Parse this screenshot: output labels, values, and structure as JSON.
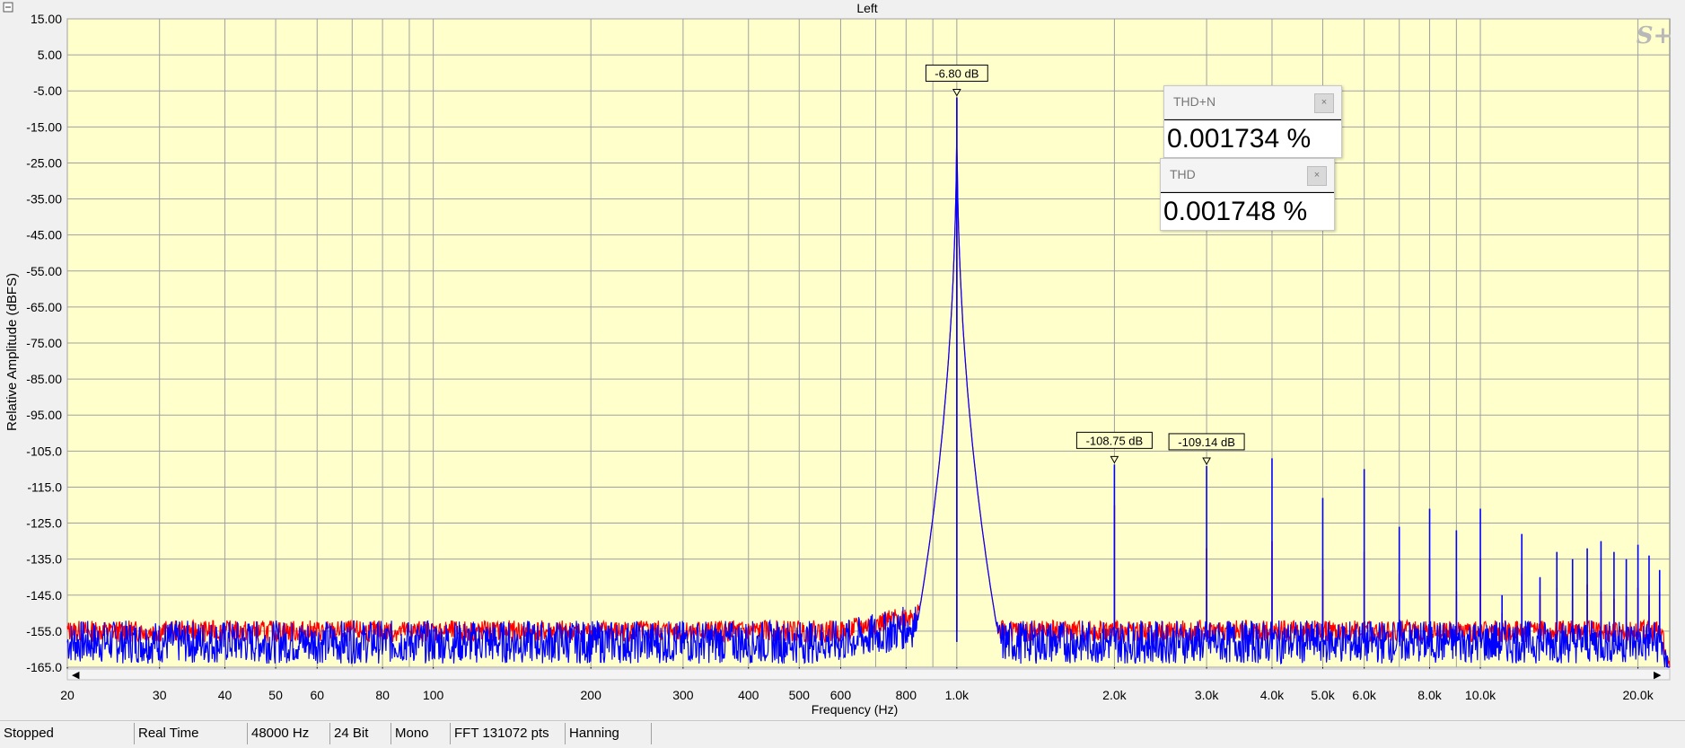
{
  "window": {
    "collapse_icon": "minus-box-icon",
    "logo_text": "S+"
  },
  "chart_data": {
    "type": "line",
    "title": "Left",
    "xlabel": "Frequency (Hz)",
    "ylabel": "Relative Amplitude (dBFS)",
    "xscale": "log",
    "xlim": [
      20,
      23000
    ],
    "ylim": [
      -165,
      15
    ],
    "grid": true,
    "y_ticks": [
      "15.00",
      "5.00",
      "-5.00",
      "-15.00",
      "-25.00",
      "-35.00",
      "-45.00",
      "-55.00",
      "-65.00",
      "-75.00",
      "-85.00",
      "-95.00",
      "-105.0",
      "-115.0",
      "-125.0",
      "-135.0",
      "-145.0",
      "-155.0",
      "-165.0"
    ],
    "x_ticks": [
      {
        "v": 20,
        "label": "20"
      },
      {
        "v": 30,
        "label": "30"
      },
      {
        "v": 40,
        "label": "40"
      },
      {
        "v": 50,
        "label": "50"
      },
      {
        "v": 60,
        "label": "60"
      },
      {
        "v": 80,
        "label": "80"
      },
      {
        "v": 100,
        "label": "100"
      },
      {
        "v": 200,
        "label": "200"
      },
      {
        "v": 300,
        "label": "300"
      },
      {
        "v": 400,
        "label": "400"
      },
      {
        "v": 500,
        "label": "500"
      },
      {
        "v": 600,
        "label": "600"
      },
      {
        "v": 800,
        "label": "800"
      },
      {
        "v": 1000,
        "label": "1.0k"
      },
      {
        "v": 2000,
        "label": "2.0k"
      },
      {
        "v": 3000,
        "label": "3.0k"
      },
      {
        "v": 4000,
        "label": "4.0k"
      },
      {
        "v": 5000,
        "label": "5.0k"
      },
      {
        "v": 6000,
        "label": "6.0k"
      },
      {
        "v": 8000,
        "label": "8.0k"
      },
      {
        "v": 10000,
        "label": "10.0k"
      },
      {
        "v": 20000,
        "label": "20.0k"
      }
    ],
    "colors": {
      "plot_bg": "#ffffcc",
      "grid": "#a0a0a0",
      "blue": "#0000ff",
      "red": "#ff0000"
    },
    "series": [
      {
        "color": "#0000ff",
        "noise_floor": -158,
        "peaks": [
          {
            "f": 1000,
            "db": -6.8
          },
          {
            "f": 2000,
            "db": -108.75
          },
          {
            "f": 3000,
            "db": -109.14
          },
          {
            "f": 4000,
            "db": -107
          },
          {
            "f": 5000,
            "db": -118
          },
          {
            "f": 6000,
            "db": -110
          },
          {
            "f": 7000,
            "db": -126
          },
          {
            "f": 8000,
            "db": -121
          },
          {
            "f": 9000,
            "db": -127
          },
          {
            "f": 10000,
            "db": -121
          },
          {
            "f": 11000,
            "db": -145
          },
          {
            "f": 12000,
            "db": -128
          },
          {
            "f": 13000,
            "db": -140
          },
          {
            "f": 14000,
            "db": -133
          },
          {
            "f": 15000,
            "db": -135
          },
          {
            "f": 16000,
            "db": -132
          },
          {
            "f": 17000,
            "db": -130
          },
          {
            "f": 18000,
            "db": -133
          },
          {
            "f": 19000,
            "db": -135
          },
          {
            "f": 20000,
            "db": -131
          },
          {
            "f": 21000,
            "db": -134
          },
          {
            "f": 22000,
            "db": -138
          }
        ]
      },
      {
        "color": "#ff0000",
        "noise_floor": -155,
        "peaks": [
          {
            "f": 1000,
            "db": -6.8
          },
          {
            "f": 2000,
            "db": -120
          },
          {
            "f": 3000,
            "db": -132
          },
          {
            "f": 4000,
            "db": -130
          },
          {
            "f": 5000,
            "db": -138
          },
          {
            "f": 6000,
            "db": -133
          },
          {
            "f": 7000,
            "db": -139
          },
          {
            "f": 8000,
            "db": -135
          },
          {
            "f": 9000,
            "db": -144
          },
          {
            "f": 10000,
            "db": -135
          },
          {
            "f": 11000,
            "db": -150
          },
          {
            "f": 12000,
            "db": -139
          },
          {
            "f": 13000,
            "db": -145
          },
          {
            "f": 14000,
            "db": -143
          },
          {
            "f": 15000,
            "db": -146
          },
          {
            "f": 16000,
            "db": -142
          },
          {
            "f": 17000,
            "db": -144
          },
          {
            "f": 18000,
            "db": -146
          },
          {
            "f": 19000,
            "db": -145
          },
          {
            "f": 20000,
            "db": -143
          },
          {
            "f": 21000,
            "db": -145
          },
          {
            "f": 22000,
            "db": -144
          }
        ]
      }
    ],
    "markers": [
      {
        "f": 1000,
        "db": -6.8,
        "label": "-6.80 dB"
      },
      {
        "f": 2000,
        "db": -108.75,
        "label": "-108.75 dB"
      },
      {
        "f": 3000,
        "db": -109.14,
        "label": "-109.14 dB"
      }
    ]
  },
  "readouts": [
    {
      "name": "THD+N",
      "value": "0.001734 %",
      "close": "×"
    },
    {
      "name": "THD",
      "value": "0.001748 %",
      "close": "×"
    }
  ],
  "status_bar": [
    "Stopped",
    "Real Time",
    "48000 Hz",
    "24 Bit",
    "Mono",
    "FFT 131072 pts",
    "Hanning"
  ]
}
